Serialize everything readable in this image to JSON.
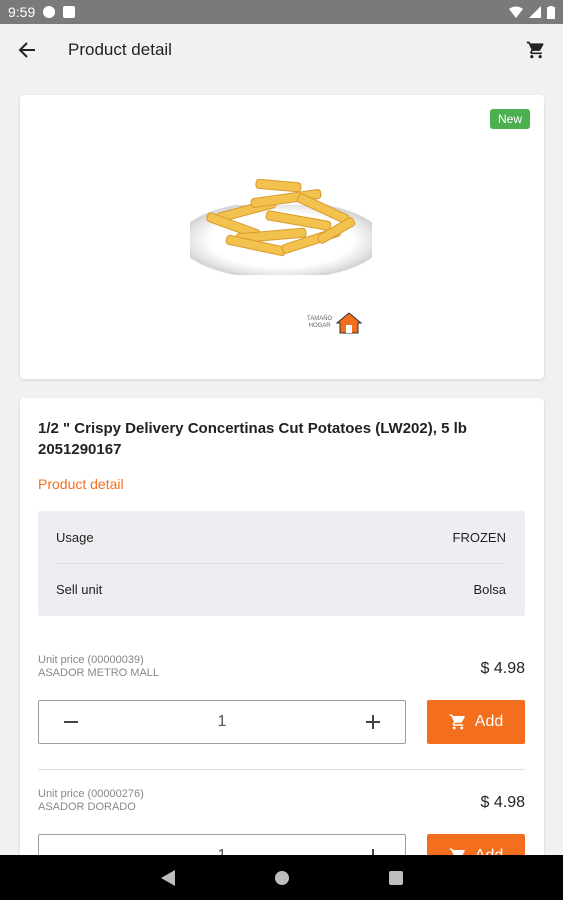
{
  "status_bar": {
    "time": "9:59"
  },
  "app_bar": {
    "title": "Product detail"
  },
  "image_card": {
    "badge": "New",
    "brand_text_line1": "TAMAÑO",
    "brand_text_line2": "HOGAR"
  },
  "product": {
    "title": "1/2 \" Crispy Delivery Concertinas Cut Potatoes (LW202), 5 lb",
    "code": "2051290167",
    "detail_link": "Product detail",
    "attributes": [
      {
        "label": "Usage",
        "value": "FROZEN"
      },
      {
        "label": "Sell unit",
        "value": "Bolsa"
      }
    ]
  },
  "offers": [
    {
      "unit_price_label": "Unit price (00000039)",
      "store": "ASADOR METRO MALL",
      "price": "$ 4.98",
      "quantity": "1",
      "add_label": "Add"
    },
    {
      "unit_price_label": "Unit price (00000276)",
      "store": "ASADOR DORADO",
      "price": "$ 4.98",
      "quantity": "1",
      "add_label": "Add"
    }
  ],
  "colors": {
    "accent": "#f36f1d",
    "badge": "#4caf50"
  }
}
